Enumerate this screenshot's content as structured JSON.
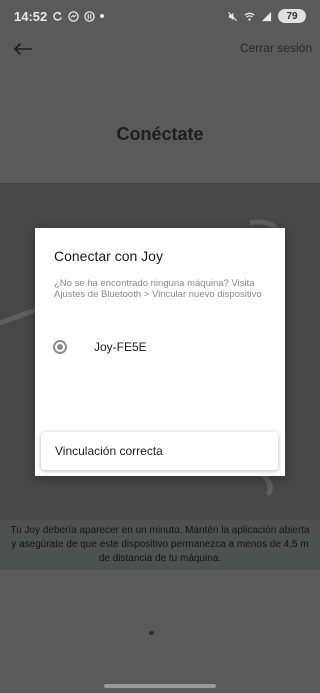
{
  "status_bar": {
    "time": "14:52",
    "battery": "79",
    "left_icons": [
      "refresh-icon",
      "messenger-icon",
      "pause-icon",
      "dot-icon"
    ],
    "right_icons": [
      "mute-icon",
      "wifi-icon",
      "signal-icon"
    ]
  },
  "header": {
    "logout_label": "Cerrar sesión",
    "title": "Conéctate"
  },
  "dialog": {
    "title": "Conectar con Joy",
    "subtitle": "¿No se ha encontrado ninguna máquina? Visita Ajustes de Bluetooth > Vincular nuevo dispositivo",
    "devices": [
      {
        "label": "Joy-FE5E",
        "selected": true
      }
    ]
  },
  "toast": {
    "message": "Vinculación correcta"
  },
  "hint": {
    "text": "Tu Joy debería aparecer en un minuto. Mantén la aplicación abierta y asegúrate de que este dispositivo permanezca a menos de 4,5 m de distancia de tu máquina."
  },
  "colors": {
    "background": "#5a5a5a",
    "band": "#474747",
    "dialog": "#ffffff",
    "accent_dot": "#1a3d2a"
  }
}
